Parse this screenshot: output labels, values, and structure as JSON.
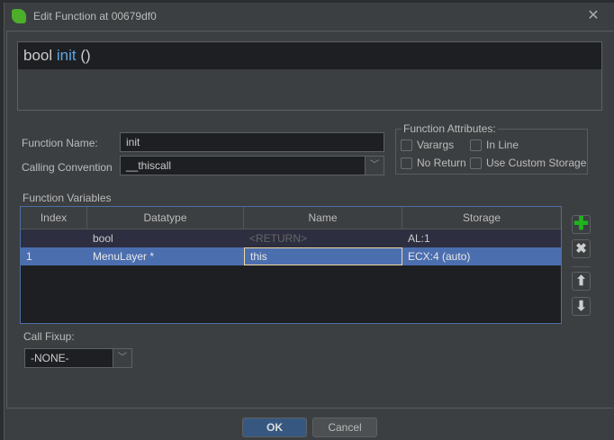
{
  "window": {
    "title": "Edit Function at 00679df0"
  },
  "signature": {
    "return_type": "bool",
    "name": "init",
    "params": "()"
  },
  "form": {
    "function_name_label": "Function Name:",
    "function_name": "init",
    "calling_convention_label": "Calling Convention",
    "calling_convention": "__thiscall"
  },
  "attributes": {
    "title": "Function Attributes:",
    "varargs": "Varargs",
    "inline": "In Line",
    "no_return": "No Return",
    "custom_storage": "Use Custom Storage"
  },
  "variables": {
    "title": "Function Variables",
    "headers": [
      "Index",
      "Datatype",
      "Name",
      "Storage"
    ],
    "rows": [
      [
        "",
        "bool",
        "<RETURN>",
        "AL:1"
      ],
      [
        "1",
        "MenuLayer *",
        "this",
        "ECX:4 (auto)"
      ]
    ]
  },
  "fixup": {
    "label": "Call Fixup:",
    "value": "-NONE-"
  },
  "buttons": {
    "ok": "OK",
    "cancel": "Cancel"
  }
}
